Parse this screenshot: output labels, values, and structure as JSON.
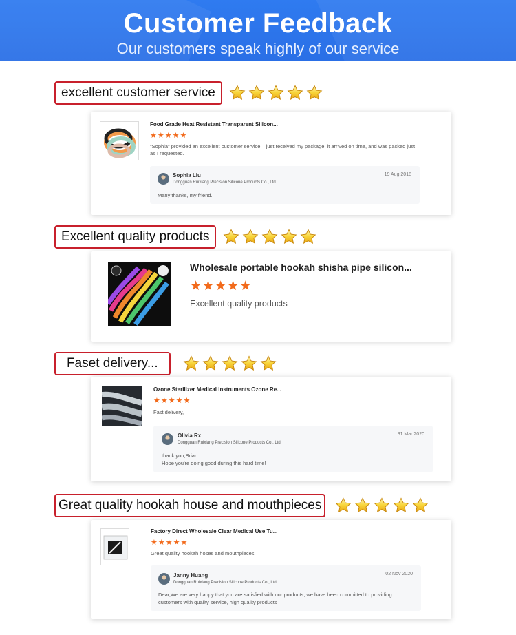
{
  "banner": {
    "title": "Customer Feedback",
    "subtitle": "Our customers speak highly of our service"
  },
  "colors": {
    "banner": "#2f7bf0",
    "headline_border": "#c8202c",
    "rating_star": "#f26a1b",
    "headline_star": "#f5c51c"
  },
  "reviews": [
    {
      "headline": "excellent customer service",
      "headline_stars": 5,
      "product_title": "Food Grade Heat Resistant Transparent Silicon...",
      "rating": 5,
      "text": "\"Sophia\" provided an excellent customer service. I just received my package, it arrived on time, and was packed just as I requested.",
      "reply": {
        "name": "Sophia Liu",
        "date": "19 Aug 2018",
        "company": "Dongguan Ruixiang Precision Silicone Products Co., Ltd.",
        "message": "Many thanks, my friend."
      }
    },
    {
      "headline": "Excellent quality products",
      "headline_stars": 5,
      "product_title": "Wholesale portable hookah shisha pipe silicon...",
      "rating": 5,
      "text": "Excellent quality products"
    },
    {
      "headline": "Faset delivery...",
      "headline_stars": 5,
      "product_title": "Ozone Sterilizer Medical Instruments Ozone Re...",
      "rating": 5,
      "text": "Fast delivery,",
      "reply": {
        "name": "Olivia Rx",
        "date": "31 Mar 2020",
        "company": "Dongguan Ruixiang Precision Silicone Products Co., Ltd.",
        "message_line1": "thank you,Brian",
        "message_line2": "Hope you're doing good during this hard time!"
      }
    },
    {
      "headline": "Great quality  hookah house and mouthpieces",
      "headline_stars": 5,
      "product_title": "Factory Direct Wholesale Clear Medical Use Tu...",
      "rating": 5,
      "text": "Great quality hookah hoses and mouthpieces",
      "reply": {
        "name": "Janny Huang",
        "date": "02 Nov 2020",
        "company": "Dongguan Ruixiang Precision Silicone Products Co., Ltd.",
        "message": "Dear,We are very happy that you are satisfied with our products, we have been committed to providing customers with quality service, high quality products"
      }
    }
  ]
}
